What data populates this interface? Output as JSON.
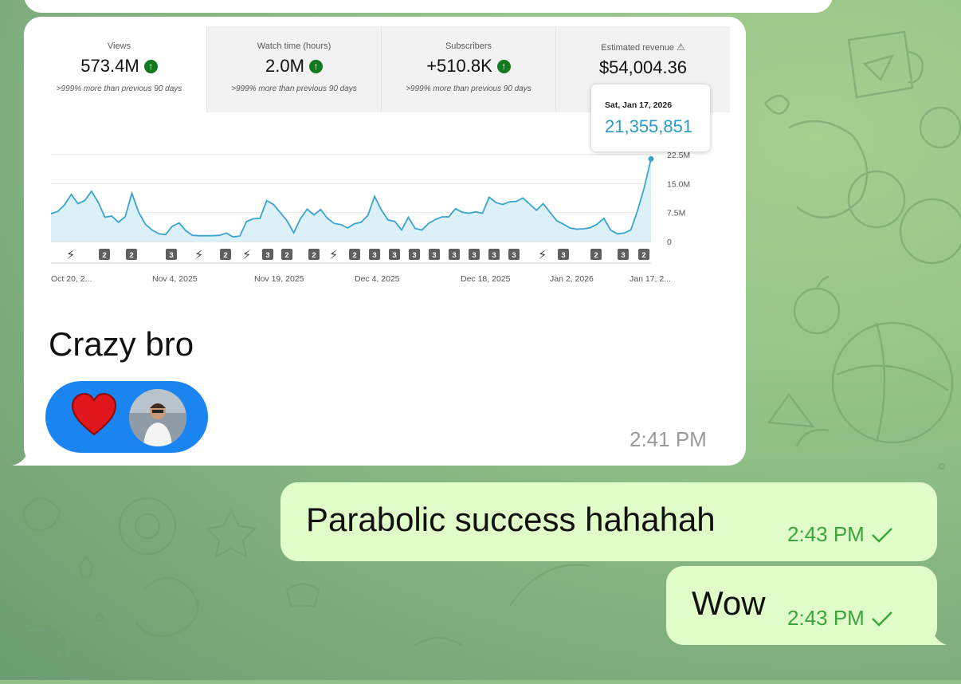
{
  "colors": {
    "chart_line": "#3aa3cf",
    "chart_fill": "#dcf0f7",
    "accent": "#2a9ac2",
    "check": "#3da53d",
    "reaction_bg": "#1a84f0"
  },
  "stats": [
    {
      "label": "Views",
      "value": "573.4M",
      "compare": ">999% more than previous 90 days",
      "icon": "arrow-up-circle-icon"
    },
    {
      "label": "Watch time (hours)",
      "value": "2.0M",
      "compare": ">999% more than previous 90 days",
      "icon": "arrow-up-circle-icon"
    },
    {
      "label": "Subscribers",
      "value": "+510.8K",
      "compare": ">999% more than previous 90 days",
      "icon": "arrow-up-circle-icon"
    },
    {
      "label": "Estimated revenue",
      "value": "$54,004.36",
      "icon": "warning-triangle-icon"
    }
  ],
  "tooltip": {
    "date": "Sat, Jan 17, 2026",
    "value": "21,355,851"
  },
  "chart_data": {
    "type": "line",
    "x_ticks": [
      "Oct 20, 2...",
      "Nov 4, 2025",
      "Nov 19, 2025",
      "Dec 4, 2025",
      "Dec 18, 2025",
      "Jan 2, 2026",
      "Jan 17, 2..."
    ],
    "y_ticks": [
      "22.5M",
      "15.0M",
      "7.5M",
      "0"
    ],
    "ylim": [
      0,
      22.5
    ],
    "unit": "M",
    "values": [
      7.2,
      7.8,
      9.5,
      12.2,
      9.8,
      10.6,
      13.0,
      10.2,
      6.3,
      6.6,
      5.0,
      6.4,
      12.5,
      7.6,
      4.5,
      3.0,
      2.0,
      1.8,
      4.0,
      4.8,
      2.8,
      1.6,
      1.5,
      1.5,
      1.5,
      1.6,
      2.2,
      1.2,
      1.4,
      5.2,
      5.9,
      6.0,
      10.6,
      9.6,
      7.5,
      5.4,
      2.3,
      5.9,
      8.4,
      6.9,
      8.3,
      6.0,
      4.7,
      4.4,
      3.5,
      4.6,
      5.0,
      6.8,
      11.7,
      8.2,
      5.6,
      5.2,
      3.0,
      6.3,
      3.4,
      3.0,
      4.7,
      5.7,
      6.4,
      6.4,
      8.5,
      7.6,
      7.3,
      7.7,
      7.3,
      11.5,
      10.1,
      9.6,
      10.3,
      10.4,
      11.3,
      9.7,
      8.1,
      9.8,
      7.6,
      5.4,
      4.5,
      3.5,
      3.2,
      3.3,
      3.6,
      4.5,
      6.0,
      3.0,
      2.0,
      2.2,
      3.0,
      8.0,
      14.0,
      21.4
    ],
    "markers": [
      "short",
      "2",
      "2",
      "3",
      "short",
      "2",
      "short",
      "3",
      "2",
      "2",
      "short",
      "2",
      "3",
      "3",
      "3",
      "3",
      "3",
      "3",
      "3",
      "3",
      "short",
      "3",
      "2",
      "3",
      "2"
    ],
    "grid": true
  },
  "messages": {
    "incoming_text": "Crazy bro",
    "incoming_time": "2:41 PM",
    "reaction": "heart",
    "outgoing": [
      {
        "text": "Parabolic success hahahah",
        "time": "2:43 PM"
      },
      {
        "text": "Wow",
        "time": "2:43 PM"
      }
    ]
  }
}
